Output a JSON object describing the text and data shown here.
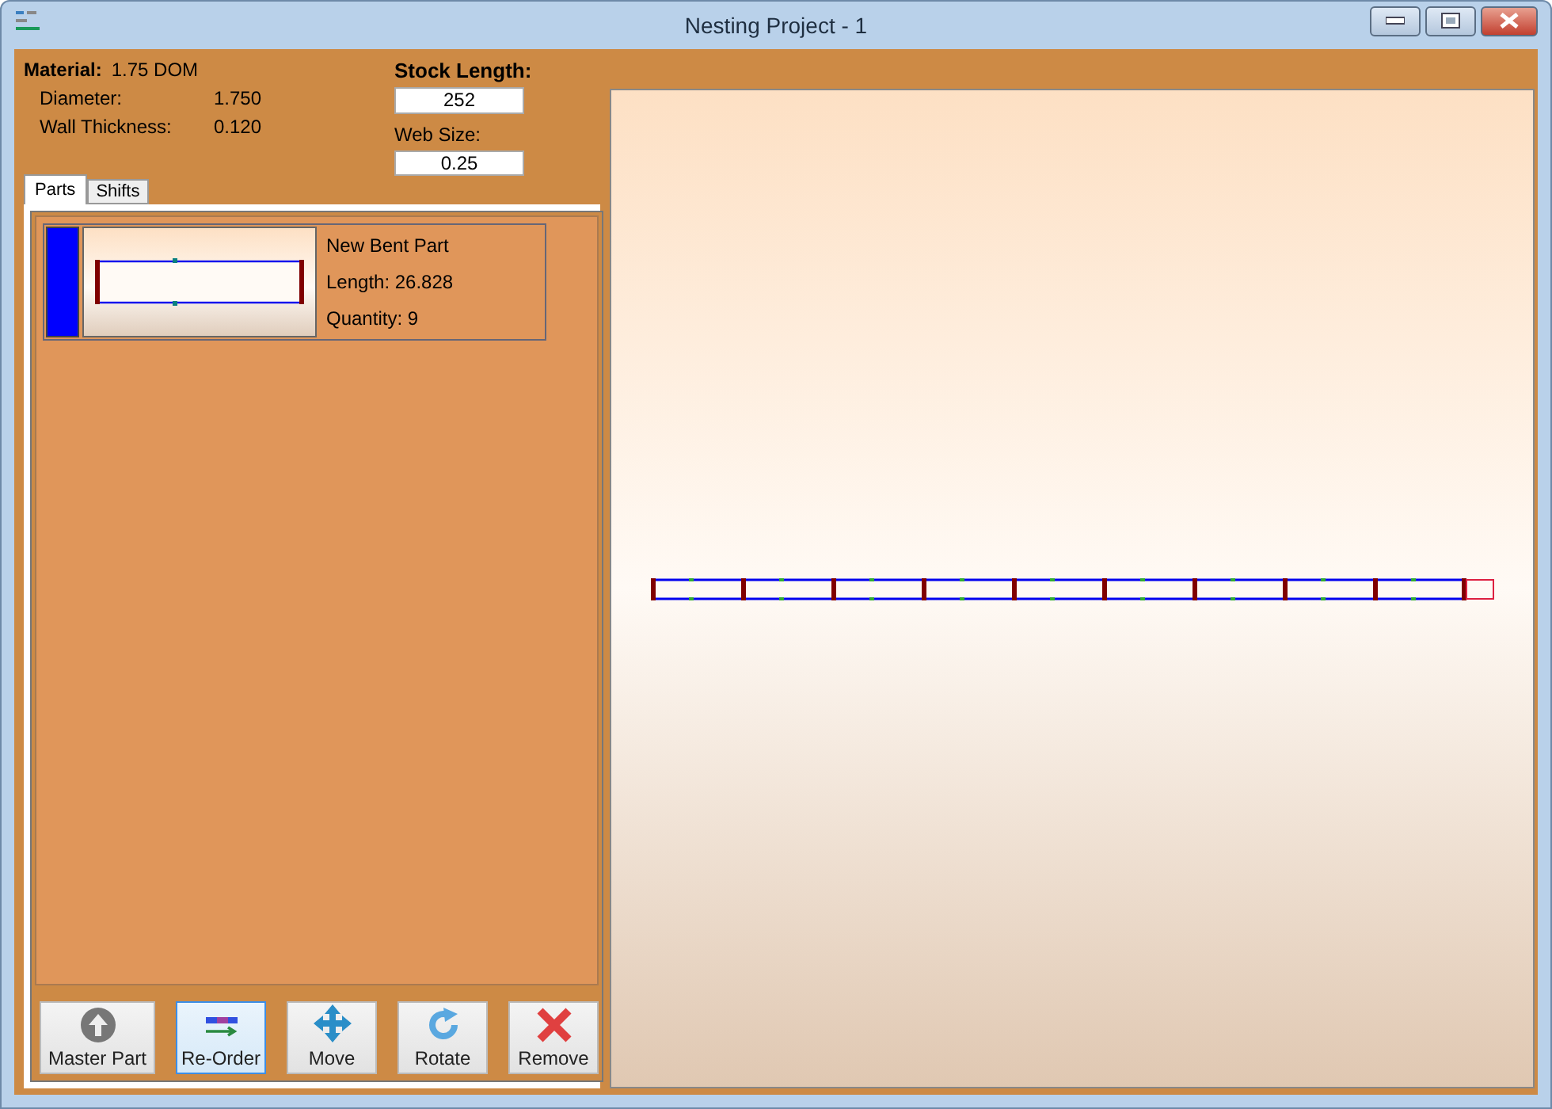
{
  "window": {
    "title": "Nesting Project - 1"
  },
  "material": {
    "label": "Material:",
    "value": "1.75 DOM",
    "properties": [
      {
        "label": "Diameter:",
        "value": "1.750"
      },
      {
        "label": "Wall Thickness:",
        "value": "0.120"
      }
    ]
  },
  "stock_length": {
    "label": "Stock Length:",
    "value": "252"
  },
  "web_size": {
    "label": "Web Size:",
    "value": "0.25"
  },
  "tabs": [
    {
      "label": "Parts",
      "selected": true
    },
    {
      "label": "Shifts",
      "selected": false
    }
  ],
  "parts": [
    {
      "color": "#0000ff",
      "name": "New Bent Part",
      "length": "Length: 26.828",
      "quantity": "Quantity: 9"
    }
  ],
  "buttons": [
    {
      "kind": "master",
      "label": "Master Part",
      "selected": false
    },
    {
      "kind": "reorder",
      "label": "Re-Order",
      "selected": true
    },
    {
      "kind": "move",
      "label": "Move",
      "selected": false
    },
    {
      "kind": "rotate",
      "label": "Rotate",
      "selected": false
    },
    {
      "kind": "remove",
      "label": "Remove",
      "selected": false
    }
  ]
}
